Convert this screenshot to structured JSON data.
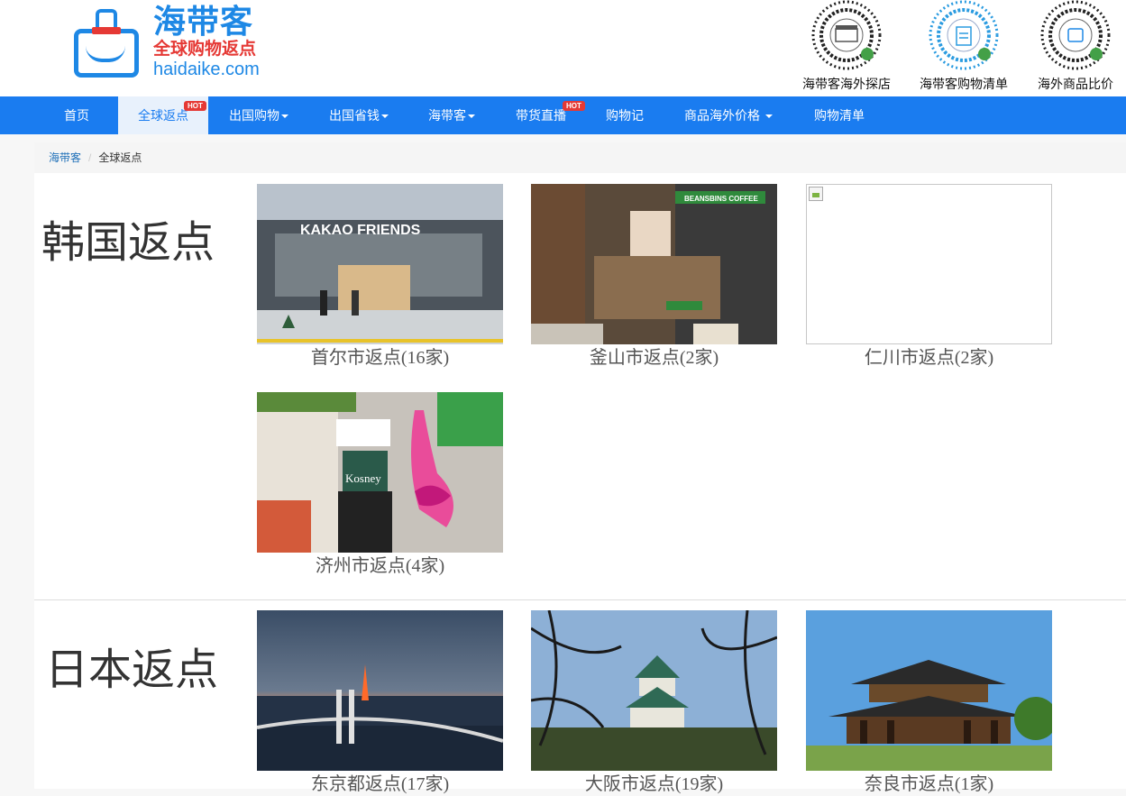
{
  "header": {
    "logo_name": "海带客",
    "logo_slogan": "全球购物返点",
    "logo_domain": "haidaike.com",
    "qr_codes": [
      {
        "label": "海带客海外探店"
      },
      {
        "label": "海带客购物清单"
      },
      {
        "label": "海外商品比价"
      }
    ]
  },
  "nav": {
    "items": [
      {
        "label": "首页",
        "dropdown": false,
        "hot": false,
        "active": false
      },
      {
        "label": "全球返点",
        "dropdown": false,
        "hot": true,
        "active": true
      },
      {
        "label": "出国购物",
        "dropdown": true,
        "hot": false,
        "active": false
      },
      {
        "label": "出国省钱",
        "dropdown": true,
        "hot": false,
        "active": false
      },
      {
        "label": "海带客",
        "dropdown": true,
        "hot": false,
        "active": false
      },
      {
        "label": "带货直播",
        "dropdown": false,
        "hot": true,
        "active": false
      },
      {
        "label": "购物记",
        "dropdown": false,
        "hot": false,
        "active": false
      },
      {
        "label": "商品海外价格",
        "dropdown": true,
        "hot": false,
        "active": false
      },
      {
        "label": "购物清单",
        "dropdown": false,
        "hot": false,
        "active": false
      }
    ],
    "hot_badge": "HOT"
  },
  "breadcrumb": {
    "home": "海带客",
    "separator": "/",
    "current": "全球返点"
  },
  "sections": [
    {
      "title": "韩国返点",
      "cities": [
        {
          "caption": "首尔市返点(16家)",
          "image": "kakao-friends-store-photo",
          "image_text": "KAKAO FRIENDS"
        },
        {
          "caption": "釜山市返点(2家)",
          "image": "beansbins-coffee-street-photo",
          "image_text": "BEANSBINS COFFEE"
        },
        {
          "caption": "仁川市返点(2家)",
          "image": "broken-image"
        },
        {
          "caption": "济州市返点(4家)",
          "image": "kosney-shoe-store-photo",
          "image_text": "Kosney"
        }
      ]
    },
    {
      "title": "日本返点",
      "cities": [
        {
          "caption": "东京都返点(17家)",
          "image": "tokyo-rainbow-bridge-photo"
        },
        {
          "caption": "大阪市返点(19家)",
          "image": "osaka-castle-photo"
        },
        {
          "caption": "奈良市返点(1家)",
          "image": "nara-todaiji-temple-photo"
        }
      ]
    }
  ],
  "colors": {
    "brand_blue": "#1a7cf0",
    "hot_red": "#e53935",
    "active_tab_bg": "#e8f1fc"
  }
}
